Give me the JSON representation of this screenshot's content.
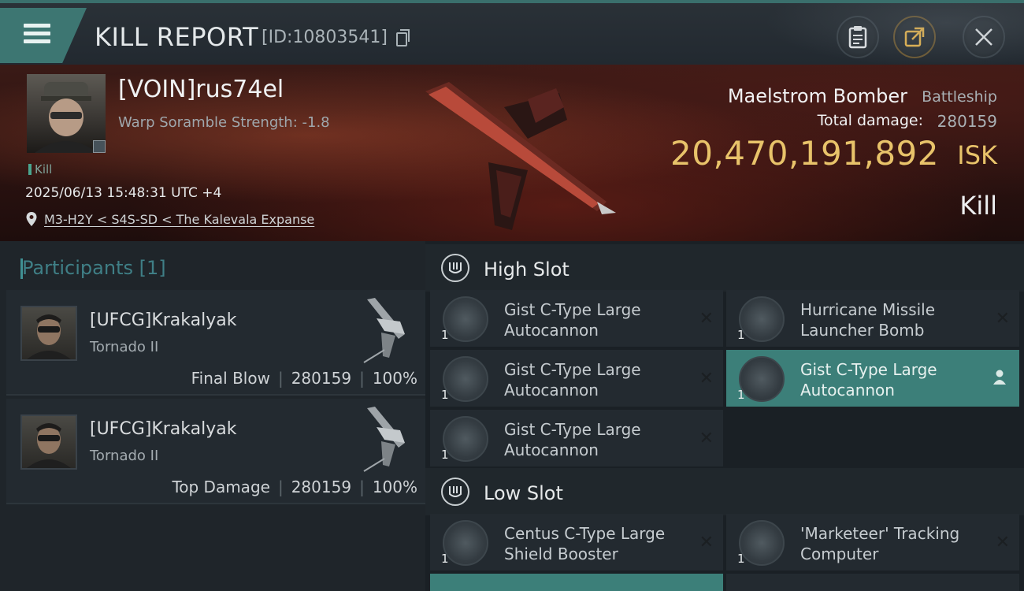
{
  "header": {
    "title": "KILL REPORT",
    "report_id": "[ID:10803541]"
  },
  "victim": {
    "name": "[VOIN]rus74el",
    "warp_scramble": "Warp Soramble Strength: -1.8",
    "kill_tag": "Kill",
    "timestamp": "2025/06/13 15:48:31 UTC +4",
    "location": "M3-H2Y < S4S-SD < The Kalevala Expanse",
    "ship_name": "Maelstrom Bomber",
    "ship_class": "Battleship",
    "total_damage_label": "Total damage:",
    "total_damage_value": "280159",
    "isk_value": "20,470,191,892",
    "isk_unit": "ISK",
    "result": "Kill"
  },
  "participants": {
    "label": "Participants",
    "count": "[1]",
    "rows": [
      {
        "name": "[UFCG]Krakalyak",
        "ship": "Tornado II",
        "role": "Final Blow",
        "damage": "280159",
        "percent": "100%"
      },
      {
        "name": "[UFCG]Krakalyak",
        "ship": "Tornado II",
        "role": "Top Damage",
        "damage": "280159",
        "percent": "100%"
      }
    ]
  },
  "fitting": {
    "high_slot_label": "High Slot",
    "low_slot_label": "Low Slot",
    "high_slot": [
      {
        "name": "Gist C-Type Large Autocannon",
        "qty": "1",
        "selected": false
      },
      {
        "name": "Hurricane Missile Launcher Bomb",
        "qty": "1",
        "selected": false
      },
      {
        "name": "Gist C-Type Large Autocannon",
        "qty": "1",
        "selected": false
      },
      {
        "name": "Gist C-Type Large Autocannon",
        "qty": "1",
        "selected": true
      },
      {
        "name": "Gist C-Type Large Autocannon",
        "qty": "1",
        "selected": false
      }
    ],
    "low_slot": [
      {
        "name": "Centus C-Type Large Shield Booster",
        "qty": "1",
        "selected": false
      },
      {
        "name": "'Marketeer' Tracking Computer",
        "qty": "1",
        "selected": false
      }
    ]
  },
  "icons": {
    "menu": "hamburger-menu-icon",
    "copy": "copy-icon",
    "clipboard": "clipboard-icon",
    "share": "share-icon",
    "close": "close-icon",
    "location": "location-pin-icon",
    "remove": "remove-x-icon",
    "user": "user-icon"
  },
  "colors": {
    "accent_teal": "#3d7672",
    "isk_gold": "#e8c36a",
    "selected_module": "#3c7f79"
  }
}
